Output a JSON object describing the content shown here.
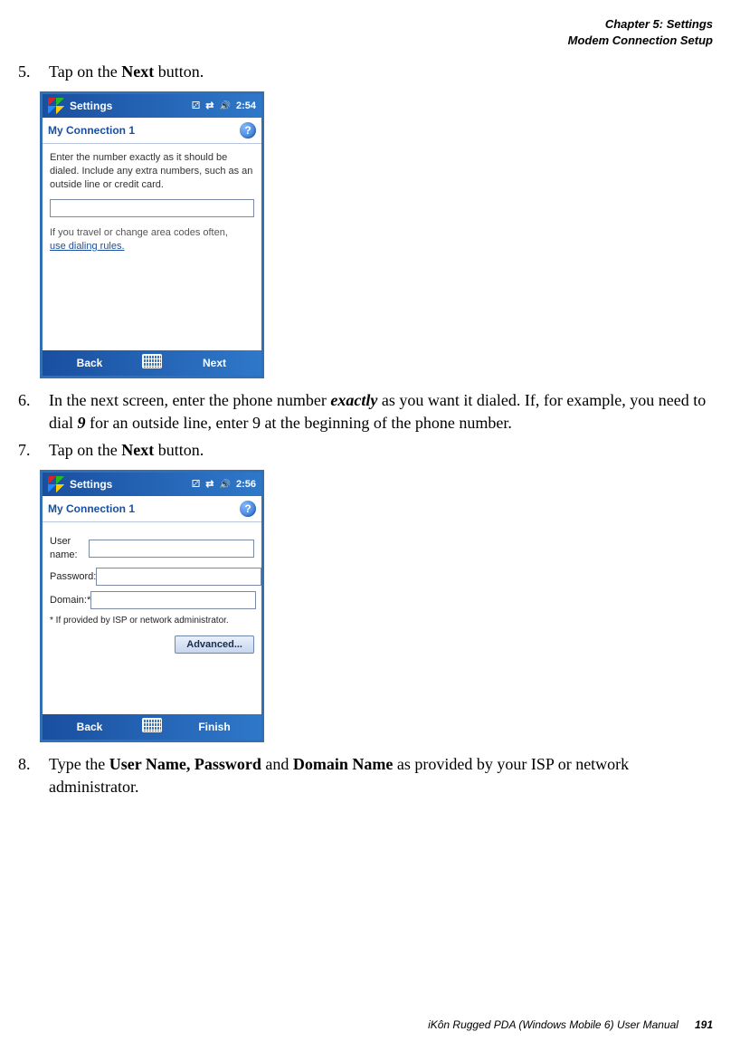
{
  "header": {
    "chapter_line": "Chapter 5:  Settings",
    "section_line": "Modem Connection Setup"
  },
  "steps": {
    "s5": {
      "num": "5.",
      "pre": "Tap on the ",
      "bold": "Next",
      "post": " button."
    },
    "s6": {
      "num": "6.",
      "t1": "In the next screen, enter the phone number ",
      "em1": "exactly",
      "t2": " as you want it dialed. If, for example, you need to dial ",
      "em2": "9",
      "t3": " for an outside line, enter 9 at the beginning of the phone number."
    },
    "s7": {
      "num": "7.",
      "pre": "Tap on the ",
      "bold": "Next",
      "post": " button."
    },
    "s8": {
      "num": "8.",
      "t1": "Type the ",
      "b1": "User Name, Password",
      "t2": " and ",
      "b2": "Domain Name",
      "t3": " as provided by your ISP or network administrator."
    }
  },
  "pda1": {
    "title": "Settings",
    "time": "2:54",
    "subtitle": "My Connection 1",
    "help": "?",
    "instr": "Enter the number exactly as it should be dialed.  Include any extra numbers, such as an outside line or credit card.",
    "note_pre": "If you travel or change area codes often,",
    "note_link": "use dialing rules.",
    "back": "Back",
    "next": "Next"
  },
  "pda2": {
    "title": "Settings",
    "time": "2:56",
    "subtitle": "My Connection 1",
    "help": "?",
    "user_label": "User name:",
    "pass_label": "Password:",
    "domain_label": "Domain:*",
    "footnote": "* If provided by ISP or network administrator.",
    "advanced": "Advanced...",
    "back": "Back",
    "finish": "Finish"
  },
  "footer": {
    "text": "iKôn Rugged PDA (Windows Mobile 6) User Manual",
    "page": "191"
  }
}
